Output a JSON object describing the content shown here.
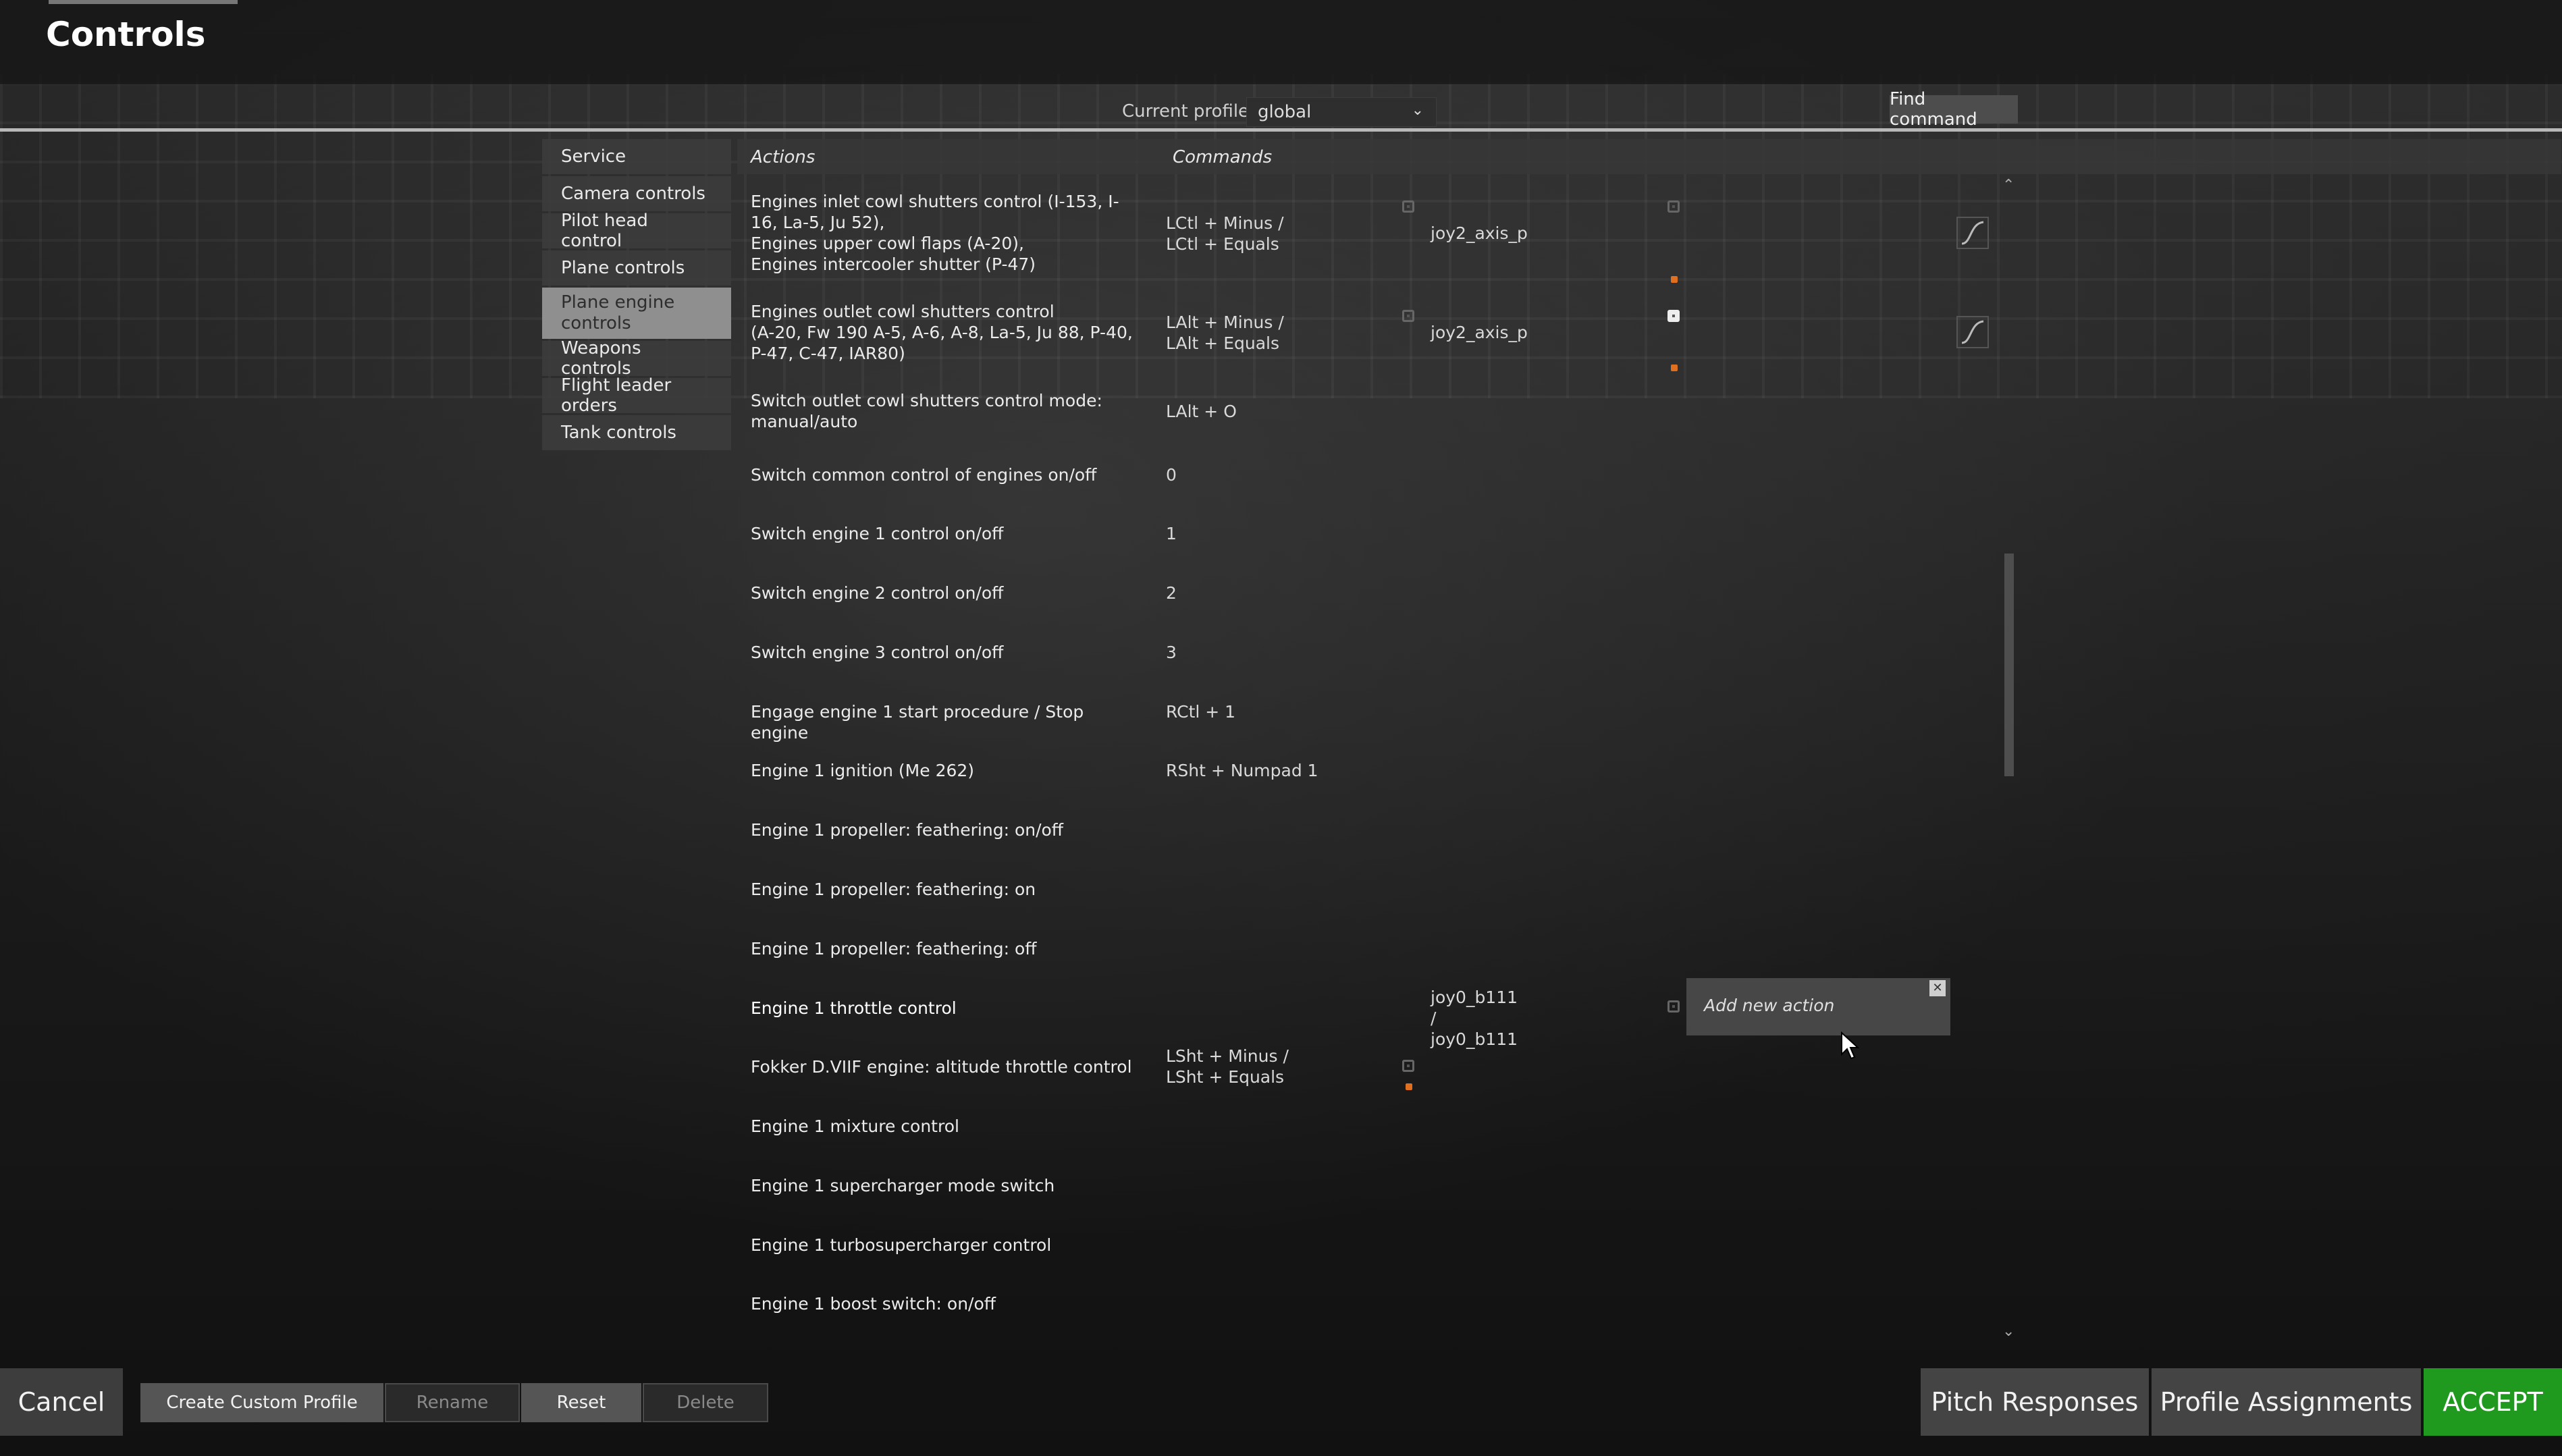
{
  "window": {
    "title": "Controls"
  },
  "profile": {
    "label": "Current profile",
    "value": "global"
  },
  "find_command": "Find command",
  "headers": {
    "actions": "Actions",
    "commands": "Commands"
  },
  "categories": [
    "Service",
    "Camera controls",
    "Pilot head control",
    "Plane controls",
    "Plane engine controls",
    "Weapons controls",
    "Flight leader orders",
    "Tank controls"
  ],
  "active_category": "Plane engine controls",
  "rows": [
    {
      "action": "Engines inlet cowl shutters control (I-153, I-16, La-5, Ju 52),\nEngines upper cowl flaps (A-20),\nEngines intercooler shutter (P-47)",
      "command": "LCtl + Minus /\nLCtl + Equals",
      "joystick": "joy2_axis_p"
    },
    {
      "action": "Engines outlet cowl shutters control\n(A-20, Fw 190 A-5, A-6, A-8, La-5, Ju 88, P-40, P-47, C-47, IAR80)",
      "command": "LAlt + Minus /\nLAlt + Equals",
      "joystick": "joy2_axis_p"
    },
    {
      "action": "Switch outlet cowl shutters control mode:\nmanual/auto",
      "command": "LAlt + O",
      "joystick": ""
    },
    {
      "action": "Switch common control of engines on/off",
      "command": "0",
      "joystick": ""
    },
    {
      "action": "Switch engine 1 control on/off",
      "command": "1",
      "joystick": ""
    },
    {
      "action": "Switch engine 2 control on/off",
      "command": "2",
      "joystick": ""
    },
    {
      "action": "Switch engine 3 control on/off",
      "command": "3",
      "joystick": ""
    },
    {
      "action": "Engage engine 1 start procedure / Stop engine",
      "command": "RCtl + 1",
      "joystick": ""
    },
    {
      "action": "Engine 1 ignition (Me 262)",
      "command": "RSht + Numpad 1",
      "joystick": ""
    },
    {
      "action": "Engine 1 propeller: feathering: on/off",
      "command": "",
      "joystick": ""
    },
    {
      "action": "Engine 1 propeller: feathering: on",
      "command": "",
      "joystick": ""
    },
    {
      "action": "Engine 1 propeller: feathering: off",
      "command": "",
      "joystick": ""
    },
    {
      "action": "Engine 1 throttle control",
      "command": "",
      "joystick": "joy0_b111 /\njoy0_b111"
    },
    {
      "action": "Fokker D.VIIF engine: altitude throttle control",
      "command": "LSht + Minus /\nLSht + Equals",
      "joystick": ""
    },
    {
      "action": "Engine 1 mixture control",
      "command": "",
      "joystick": ""
    },
    {
      "action": "Engine 1 supercharger mode switch",
      "command": "",
      "joystick": ""
    },
    {
      "action": "Engine 1 turbosupercharger control",
      "command": "",
      "joystick": ""
    },
    {
      "action": "Engine 1 boost switch: on/off",
      "command": "",
      "joystick": ""
    }
  ],
  "add_new_action": "Add new action",
  "buttons": {
    "cancel": "Cancel",
    "create_custom_profile": "Create Custom Profile",
    "rename": "Rename",
    "reset": "Reset",
    "delete": "Delete",
    "pitch_responses": "Pitch Responses",
    "profile_assignments": "Profile Assignments",
    "accept": "ACCEPT"
  },
  "colors": {
    "accept": "#1f9a1f",
    "highlight_dot": "#e07020"
  }
}
